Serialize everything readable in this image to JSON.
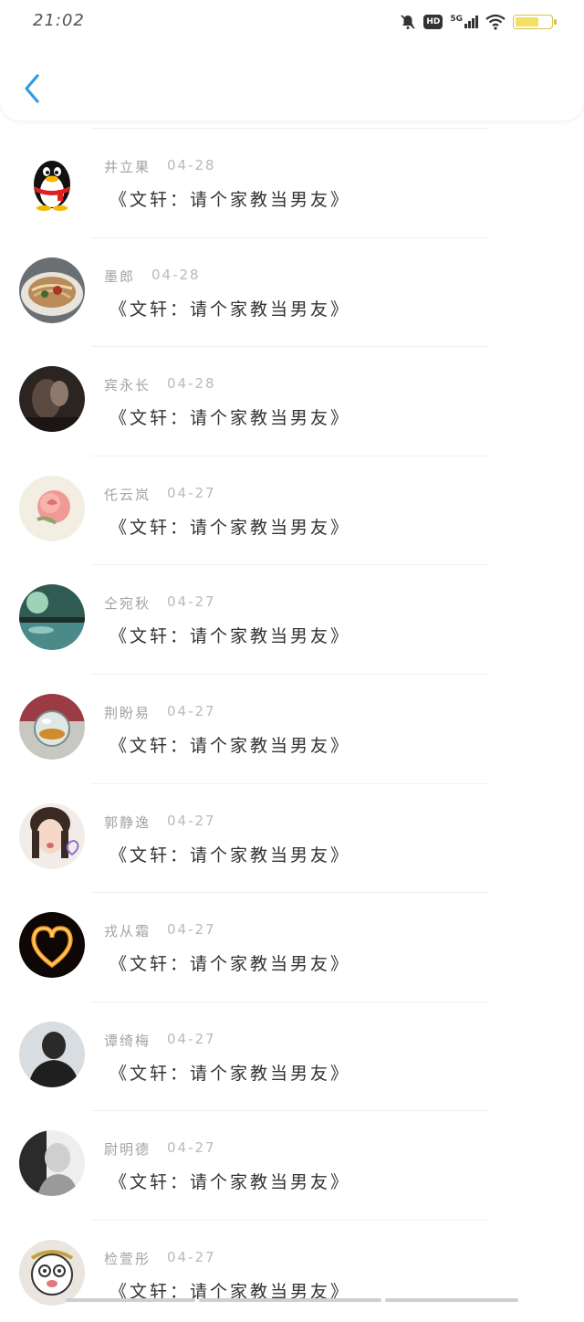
{
  "status_bar": {
    "time": "21:02",
    "hd_label": "HD",
    "network_label": "5G"
  },
  "header": {
    "back_icon": "chevron-left-icon"
  },
  "messages": [
    {
      "name": "井立果",
      "date": "04-28",
      "text": "《文轩：请个家教当男友》",
      "avatar": "qq-penguin"
    },
    {
      "name": "墨郎",
      "date": "04-28",
      "text": "《文轩：请个家教当男友》",
      "avatar": "food-bowl"
    },
    {
      "name": "宾永长",
      "date": "04-28",
      "text": "《文轩：请个家教当男友》",
      "avatar": "dark-couple"
    },
    {
      "name": "仛云岚",
      "date": "04-27",
      "text": "《文轩：请个家教当男友》",
      "avatar": "pink-rose"
    },
    {
      "name": "仝宛秋",
      "date": "04-27",
      "text": "《文轩：请个家教当男友》",
      "avatar": "lake-landscape"
    },
    {
      "name": "荆盼易",
      "date": "04-27",
      "text": "《文轩：请个家教当男友》",
      "avatar": "crystal-ball"
    },
    {
      "name": "郭静逸",
      "date": "04-27",
      "text": "《文轩：请个家教当男友》",
      "avatar": "girl-portrait"
    },
    {
      "name": "戎从霜",
      "date": "04-27",
      "text": "《文轩：请个家教当男友》",
      "avatar": "fire-heart"
    },
    {
      "name": "谭绮梅",
      "date": "04-27",
      "text": "《文轩：请个家教当男友》",
      "avatar": "man-silhouette"
    },
    {
      "name": "尉明德",
      "date": "04-27",
      "text": "《文轩：请个家教当男友》",
      "avatar": "bw-portrait"
    },
    {
      "name": "检萱彤",
      "date": "04-27",
      "text": "《文轩：请个家教当男友》",
      "avatar": "cartoon-face"
    }
  ],
  "colors": {
    "accent": "#2f9be6",
    "name_gray": "#a3a3a3",
    "text": "#333333"
  }
}
